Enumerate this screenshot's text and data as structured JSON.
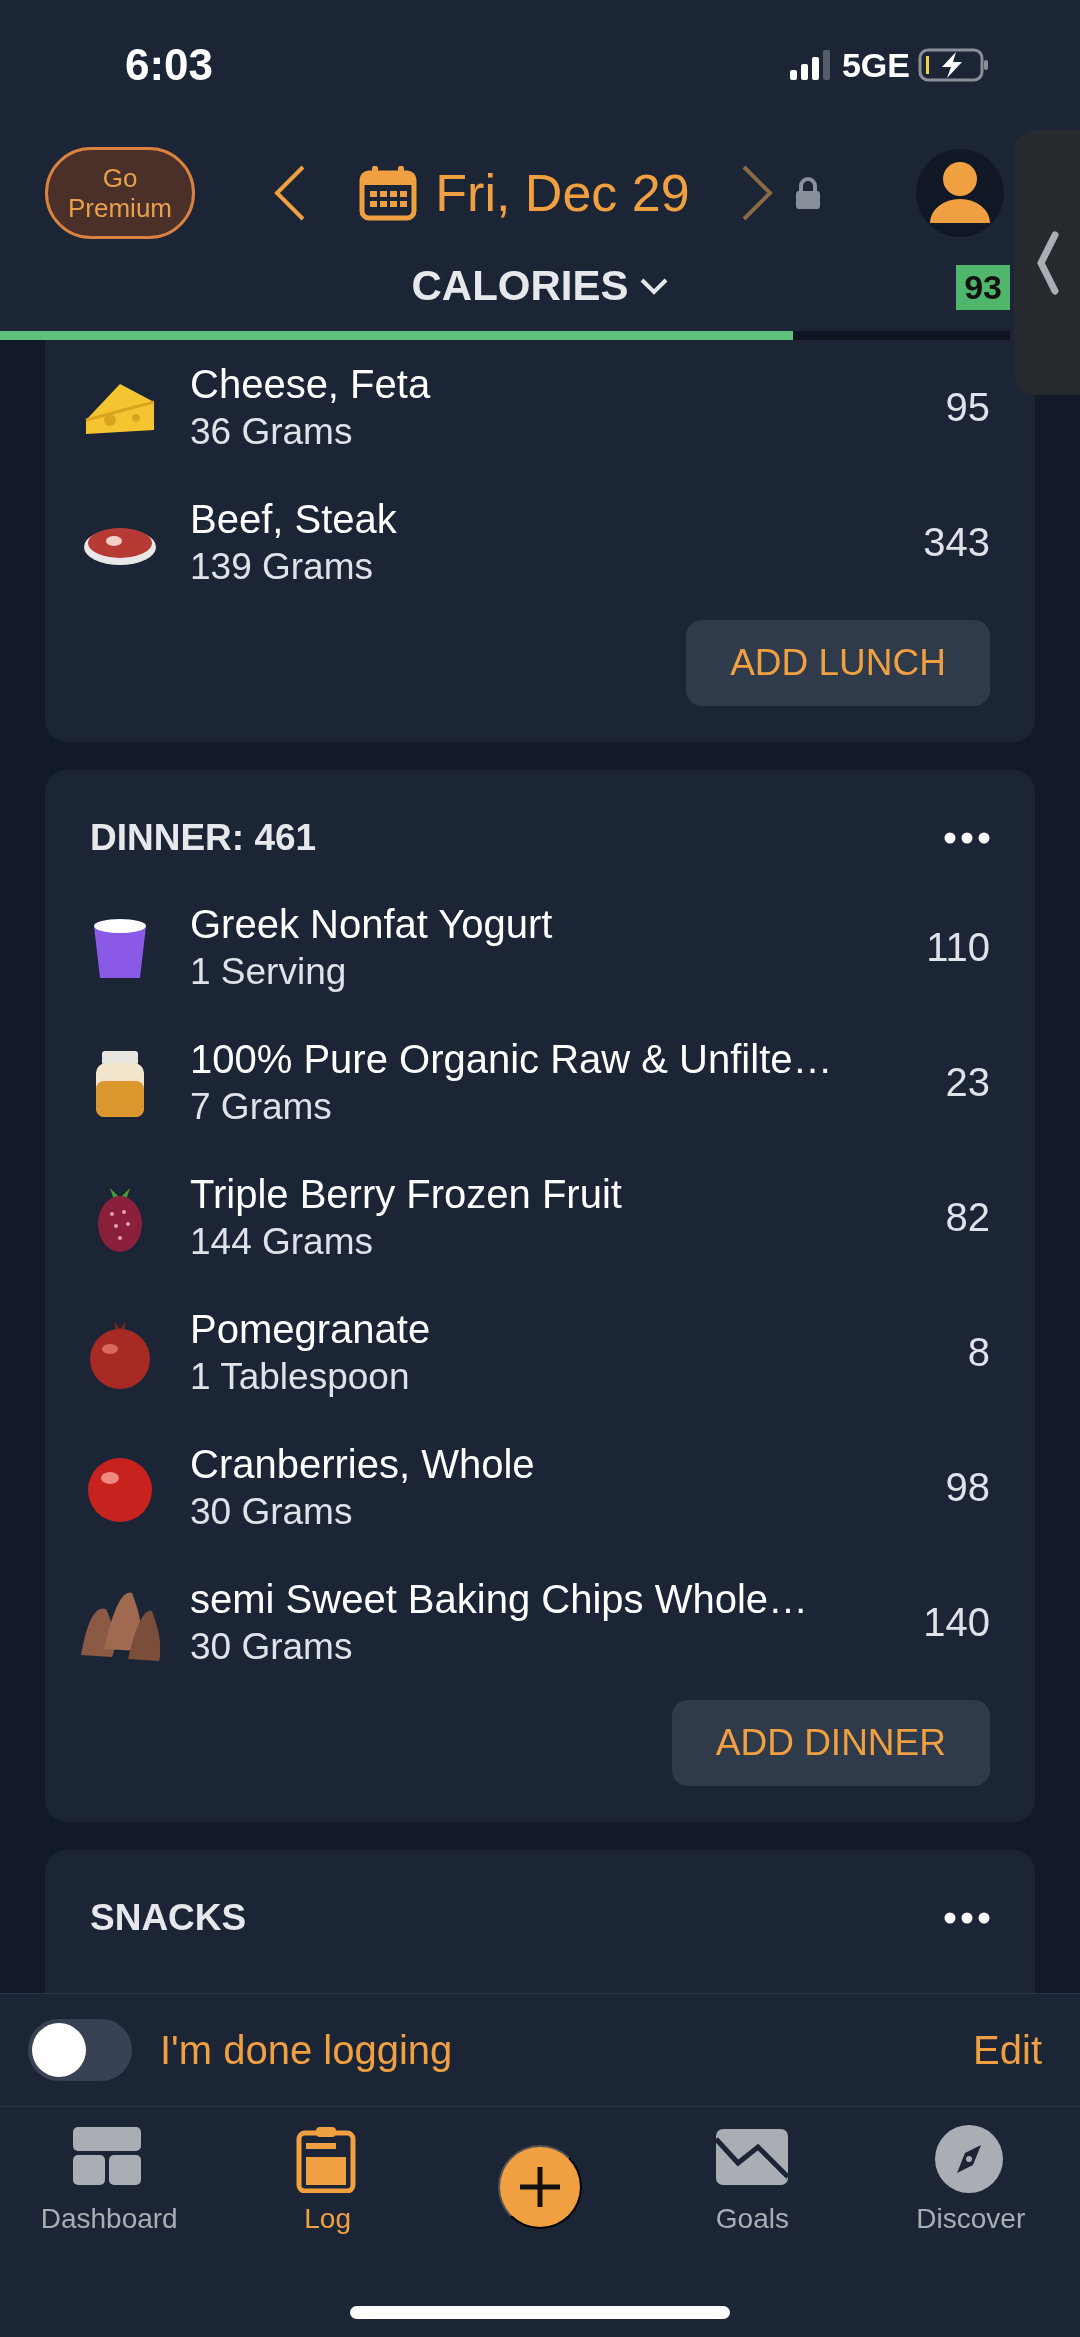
{
  "status_bar": {
    "time": "6:03",
    "network": "5GE"
  },
  "header": {
    "premium_button": "Go Premium",
    "date": "Fri, Dec 29",
    "locked": true
  },
  "nutrient_selector": {
    "label": "CALORIES",
    "score": "93",
    "progress": {
      "level": 0.785
    }
  },
  "meals": [
    {
      "items": [
        {
          "kind": "cheese",
          "name": "Cheese, Feta",
          "amount": "36 Grams",
          "calories": "95"
        },
        {
          "kind": "steak",
          "name": "Beef, Steak",
          "amount": "139 Grams",
          "calories": "343"
        }
      ],
      "add_button": "ADD LUNCH"
    },
    {
      "title": "DINNER: 461",
      "items": [
        {
          "kind": "yogurt",
          "name": "Greek Nonfat Yogurt",
          "amount": "1 Serving",
          "calories": "110"
        },
        {
          "kind": "jar",
          "name": "100% Pure Organic Raw & Unfilte…",
          "amount": "7 Grams",
          "calories": "23"
        },
        {
          "kind": "berry",
          "name": "Triple Berry Frozen Fruit",
          "amount": "144 Grams",
          "calories": "82"
        },
        {
          "kind": "pomegranate",
          "name": "Pomegranate",
          "amount": "1 Tablespoon",
          "calories": "8"
        },
        {
          "kind": "cranberry",
          "name": "Cranberries, Whole",
          "amount": "30 Grams",
          "calories": "98"
        },
        {
          "kind": "chips",
          "name": "semi Sweet Baking Chips Whole…",
          "amount": "30 Grams",
          "calories": "140"
        }
      ],
      "add_button": "ADD DINNER"
    },
    {
      "title": "SNACKS"
    }
  ],
  "done_logging": {
    "label": "I'm done logging",
    "on": false,
    "edit": "Edit"
  },
  "tab_bar": [
    {
      "kind": "dashboard",
      "label": "Dashboard",
      "selected": false
    },
    {
      "kind": "log",
      "label": "Log",
      "selected": true
    },
    {
      "kind": "add",
      "selected": false
    },
    {
      "kind": "goals",
      "label": "Goals",
      "selected": false
    },
    {
      "kind": "discover",
      "label": "Discover",
      "selected": false
    }
  ]
}
